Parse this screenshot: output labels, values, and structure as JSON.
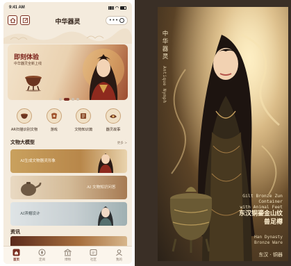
{
  "phone": {
    "status": {
      "time": "9:41 AM"
    },
    "title": "中华器灵",
    "banner": {
      "title": "即刻体验",
      "subtitle": "中华器灵全新上线"
    },
    "menu": [
      {
        "label": "AR扫描识别文物",
        "icon": "scan-icon"
      },
      {
        "label": "游戏",
        "icon": "game-icon"
      },
      {
        "label": "文物知识篇",
        "icon": "book-icon"
      },
      {
        "label": "器灵故事",
        "icon": "story-icon"
      }
    ],
    "model_section": {
      "title": "文物大模型",
      "more": "更多 >"
    },
    "cards": [
      {
        "label": "AI生成文物器灵形象"
      },
      {
        "label": "AI 文物知识问答"
      },
      {
        "label": "AI滨帽设计"
      }
    ],
    "news_section": {
      "title": "资讯"
    },
    "tabs": [
      {
        "label": "首页",
        "icon": "home-icon",
        "active": true
      },
      {
        "label": "定阅",
        "icon": "compass-icon",
        "active": false
      },
      {
        "label": "博物",
        "icon": "museum-icon",
        "active": false
      },
      {
        "label": "社区",
        "icon": "community-icon",
        "active": false
      },
      {
        "label": "我的",
        "icon": "profile-icon",
        "active": false
      }
    ]
  },
  "poster": {
    "vertical_title": [
      "中",
      "华",
      "器",
      "灵"
    ],
    "vertical_subtitle": "Antique Nymph",
    "caption_en": [
      "Gilt Bronze Zun Container",
      "with Animal Feet"
    ],
    "caption_cn": [
      "东汉铜鎏金山纹",
      "兽足樽"
    ],
    "caption_dynasty": [
      "Han Dynasty",
      "Bronze Ware"
    ],
    "caption_footer": "东汉 · 铜器"
  },
  "colors": {
    "accent": "#7a2e22",
    "background": "#f4ebdd",
    "poster_bg": "#3a2f26",
    "gold": "#c9a15e"
  }
}
